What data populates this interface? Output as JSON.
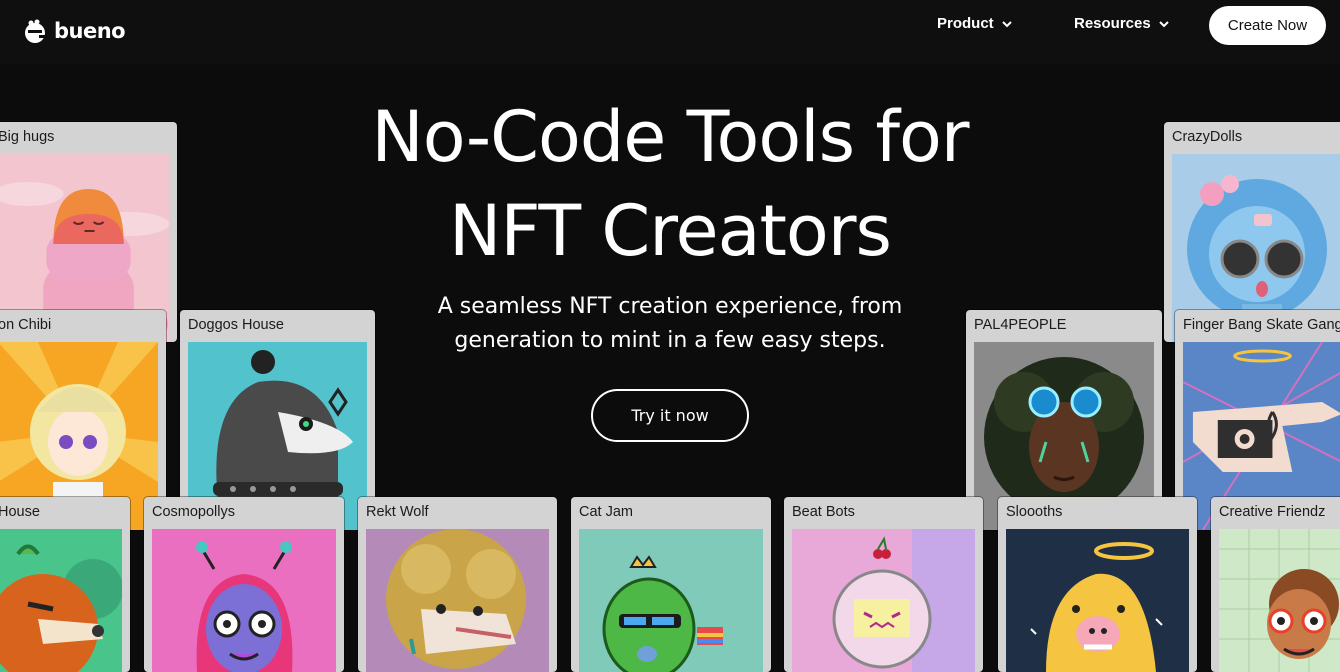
{
  "header": {
    "brand": "bueno",
    "nav": [
      {
        "label": "Product"
      },
      {
        "label": "Resources"
      }
    ],
    "cta_label": "Create Now"
  },
  "hero": {
    "title_line1": "No-Code Tools for",
    "title_line2": "NFT Creators",
    "subtitle_line1": "A seamless NFT creation experience, from",
    "subtitle_line2": "generation to mint in a few easy steps.",
    "button_label": "Try it now"
  },
  "cards": {
    "big_hugs": "Big hugs",
    "crazy_dolls": "CrazyDolls",
    "on_chibi": "on Chibi",
    "doggos_house": "Doggos House",
    "pal4people": "PAL4PEOPLE",
    "finger_bang": "Finger Bang Skate Gang",
    "house": "House",
    "cosmopollys": "Cosmopollys",
    "rekt_wolf": "Rekt Wolf",
    "cat_jam": "Cat Jam",
    "beat_bots": "Beat Bots",
    "sloooths": "Sloooths",
    "creative_friendz": "Creative Friendz"
  },
  "colors": {
    "background": "#0c0c0c",
    "card_frame": "#d3d3d3",
    "text": "#ffffff"
  }
}
